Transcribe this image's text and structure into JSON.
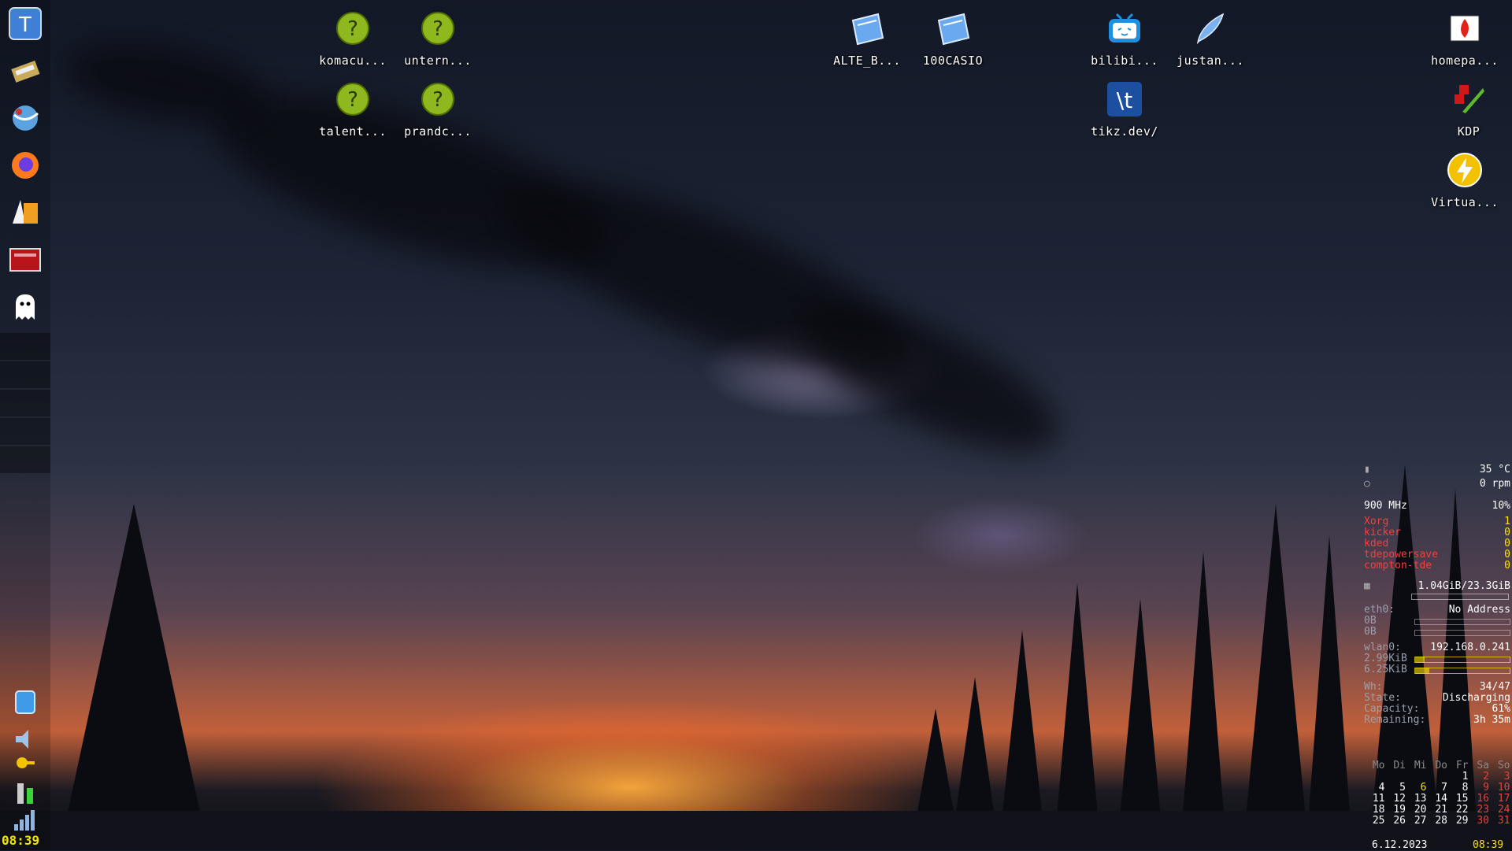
{
  "desktop_icons": [
    {
      "label": "komacu...",
      "icon": "unknown-file-icon"
    },
    {
      "label": "untern...",
      "icon": "unknown-file-icon"
    },
    {
      "label": "talent...",
      "icon": "unknown-file-icon"
    },
    {
      "label": "prandc...",
      "icon": "unknown-file-icon"
    },
    {
      "label": "ALTE_B...",
      "icon": "folder-icon"
    },
    {
      "label": "100CASIO",
      "icon": "folder-icon"
    },
    {
      "label": "bilibi...",
      "icon": "bilibili-icon"
    },
    {
      "label": "justan...",
      "icon": "feather-icon"
    },
    {
      "label": "tikz.dev/",
      "icon": "tikz-icon"
    },
    {
      "label": "homepa...",
      "icon": "flame-icon"
    },
    {
      "label": "KDP",
      "icon": "kdp-icon"
    },
    {
      "label": "Virtua...",
      "icon": "lightning-icon"
    }
  ],
  "sidebar": {
    "launchers": [
      "tde-menu-icon",
      "package-manager-icon",
      "web-browser-icon",
      "firefox-icon",
      "office-icon",
      "terminal-icon",
      "ghost-icon"
    ],
    "tray": [
      "trash-icon",
      "volume-icon",
      "key-icon",
      "battery-icon",
      "network-signal-icon"
    ],
    "clock": "08:39"
  },
  "conky": {
    "temp": "35  °C",
    "fan": "0 rpm",
    "cpu_freq": "900 MHz",
    "cpu_load": "10%",
    "processes": [
      {
        "name": "Xorg",
        "val": "1"
      },
      {
        "name": "kicker",
        "val": "0"
      },
      {
        "name": "kded",
        "val": "0"
      },
      {
        "name": "tdepowersave",
        "val": "0"
      },
      {
        "name": "compton-tde",
        "val": "0"
      }
    ],
    "memory": "1.04GiB/23.3GiB",
    "eth0_label": "eth0:",
    "eth0_addr": "No Address",
    "eth0_up": "0B",
    "eth0_down": "0B",
    "wlan0_label": "wlan0:",
    "wlan0_addr": "192.168.0.241",
    "wlan0_up": "2.99KiB",
    "wlan0_down": "6.25KiB",
    "wh_label": "Wh:",
    "wh_val": "34/47",
    "state_label": "State:",
    "state_val": "Discharging",
    "capacity_label": "Capacity:",
    "capacity_val": "61%",
    "remaining_label": "Remaining:",
    "remaining_val": "3h 35m"
  },
  "calendar": {
    "headers": [
      "Mo",
      "Di",
      "Mi",
      "Do",
      "Fr",
      "Sa",
      "So"
    ],
    "weeks": [
      [
        "",
        "",
        "",
        "",
        "1",
        "2",
        "3"
      ],
      [
        "4",
        "5",
        "6",
        "7",
        "8",
        "9",
        "10"
      ],
      [
        "11",
        "12",
        "13",
        "14",
        "15",
        "16",
        "17"
      ],
      [
        "18",
        "19",
        "20",
        "21",
        "22",
        "23",
        "24"
      ],
      [
        "25",
        "26",
        "27",
        "28",
        "29",
        "30",
        "31"
      ]
    ],
    "today": "6",
    "date": "6.12.2023",
    "time": "08:39"
  },
  "colors": {
    "accent_yellow": "#ffe100",
    "process_red": "#ff3b3b",
    "weekend_red": "#e0453a"
  }
}
